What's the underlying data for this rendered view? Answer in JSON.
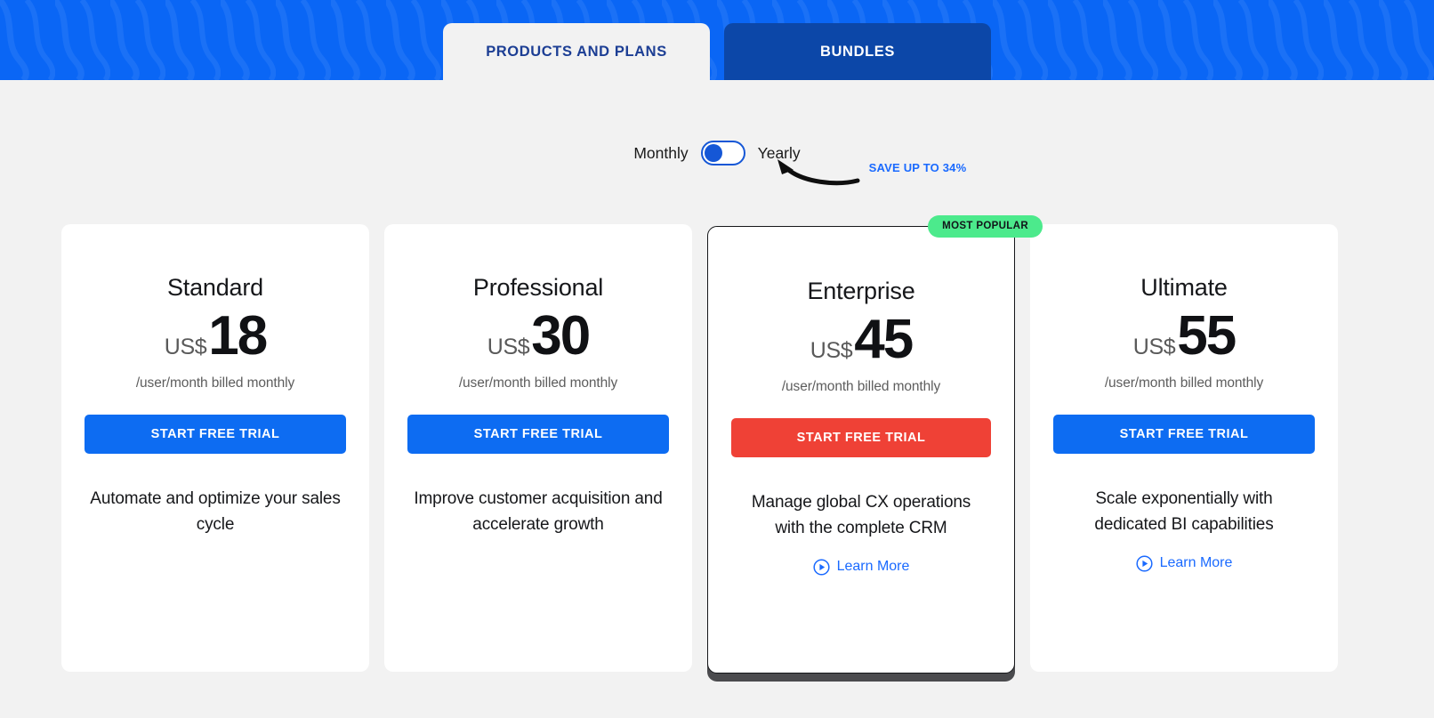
{
  "header": {
    "tabs": [
      {
        "label": "PRODUCTS AND PLANS",
        "state": "active"
      },
      {
        "label": "BUNDLES",
        "state": "inactive"
      }
    ],
    "accent_blue": "#0a66f5",
    "tab_active_text": "#1c3e94",
    "tab_inactive_bg": "#0c47a8"
  },
  "billing_toggle": {
    "left_label": "Monthly",
    "right_label": "Yearly",
    "save_note": "SAVE UP TO 34%",
    "selected": "Monthly",
    "knob_color": "#1557d6",
    "save_note_color": "#1a6aff"
  },
  "plans": [
    {
      "name": "Standard",
      "currency": "US$",
      "price": "18",
      "billing_note": "/user/month billed monthly",
      "cta_label": "START FREE TRIAL",
      "cta_color": "#0d6cf2",
      "description": "Automate and optimize your sales cycle",
      "badge": "",
      "learn_more": "",
      "featured": "false"
    },
    {
      "name": "Professional",
      "currency": "US$",
      "price": "30",
      "billing_note": "/user/month billed monthly",
      "cta_label": "START FREE TRIAL",
      "cta_color": "#0d6cf2",
      "description": "Improve customer acquisition and accelerate growth",
      "badge": "",
      "learn_more": "",
      "featured": "false"
    },
    {
      "name": "Enterprise",
      "currency": "US$",
      "price": "45",
      "billing_note": "/user/month billed monthly",
      "cta_label": "START FREE TRIAL",
      "cta_color": "#ef4136",
      "description": "Manage global CX operations with the complete CRM",
      "badge": "MOST POPULAR",
      "badge_color": "#4cea8c",
      "learn_more": "Learn More",
      "featured": "true"
    },
    {
      "name": "Ultimate",
      "currency": "US$",
      "price": "55",
      "billing_note": "/user/month billed monthly",
      "cta_label": "START FREE TRIAL",
      "cta_color": "#0d6cf2",
      "description": "Scale exponentially with dedicated BI capabilities",
      "badge": "",
      "learn_more": "Learn More",
      "featured": "false"
    }
  ],
  "icons": {
    "play_circle": "play-circle-icon",
    "curved_arrow": "curved-arrow-icon"
  }
}
